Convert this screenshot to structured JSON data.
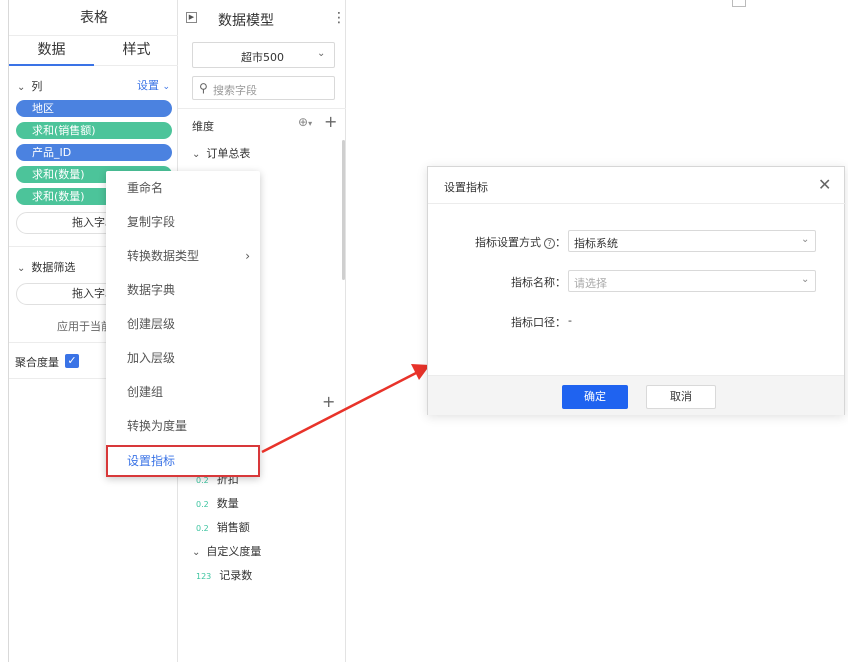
{
  "left_panel": {
    "title": "表格",
    "tabs": [
      "数据",
      "样式"
    ],
    "columns": {
      "label": "列",
      "settings": "设置",
      "fields": [
        {
          "label": "地区",
          "color": "#4b82e0"
        },
        {
          "label": "求和(销售额)",
          "color": "#4cc49a"
        },
        {
          "label": "产品_ID",
          "color": "#4b82e0"
        },
        {
          "label": "求和(数量)",
          "color": "#4cc49a"
        },
        {
          "label": "求和(数量)",
          "color": "#4cc49a"
        }
      ],
      "drop_text": "拖入字段"
    },
    "filter": {
      "label": "数据筛选",
      "drop_text": "拖入字段",
      "apply_text": "应用于当前"
    },
    "aggregate": {
      "label": "聚合度量",
      "checked": true
    }
  },
  "middle_panel": {
    "title": "数据模型",
    "model": "超市500",
    "search_placeholder": "搜索字段",
    "dimension_label": "维度",
    "order_table": "订单总表",
    "measures": [
      {
        "type": "0.2",
        "label": "折扣"
      },
      {
        "type": "0.2",
        "label": "数量"
      },
      {
        "type": "0.2",
        "label": "销售额"
      }
    ],
    "custom_measure": "自定义度量",
    "custom_items": [
      {
        "type": "123",
        "label": "记录数"
      }
    ]
  },
  "context_menu": {
    "items": [
      "重命名",
      "复制字段",
      "转换数据类型",
      "数据字典",
      "创建层级",
      "加入层级",
      "创建组",
      "转换为度量",
      "设置指标"
    ],
    "highlighted": "设置指标"
  },
  "dialog": {
    "title": "设置指标",
    "mode_label": "指标设置方式",
    "mode_value": "指标系统",
    "name_label": "指标名称：",
    "name_placeholder": "请选择",
    "caliber_label": "指标口径：",
    "caliber_value": "-",
    "ok": "确定",
    "cancel": "取消"
  },
  "colors": {
    "accent": "#3a73e6",
    "primary_button": "#1f63f0",
    "highlight_box": "#d8383a",
    "arrow": "#e8332a"
  }
}
